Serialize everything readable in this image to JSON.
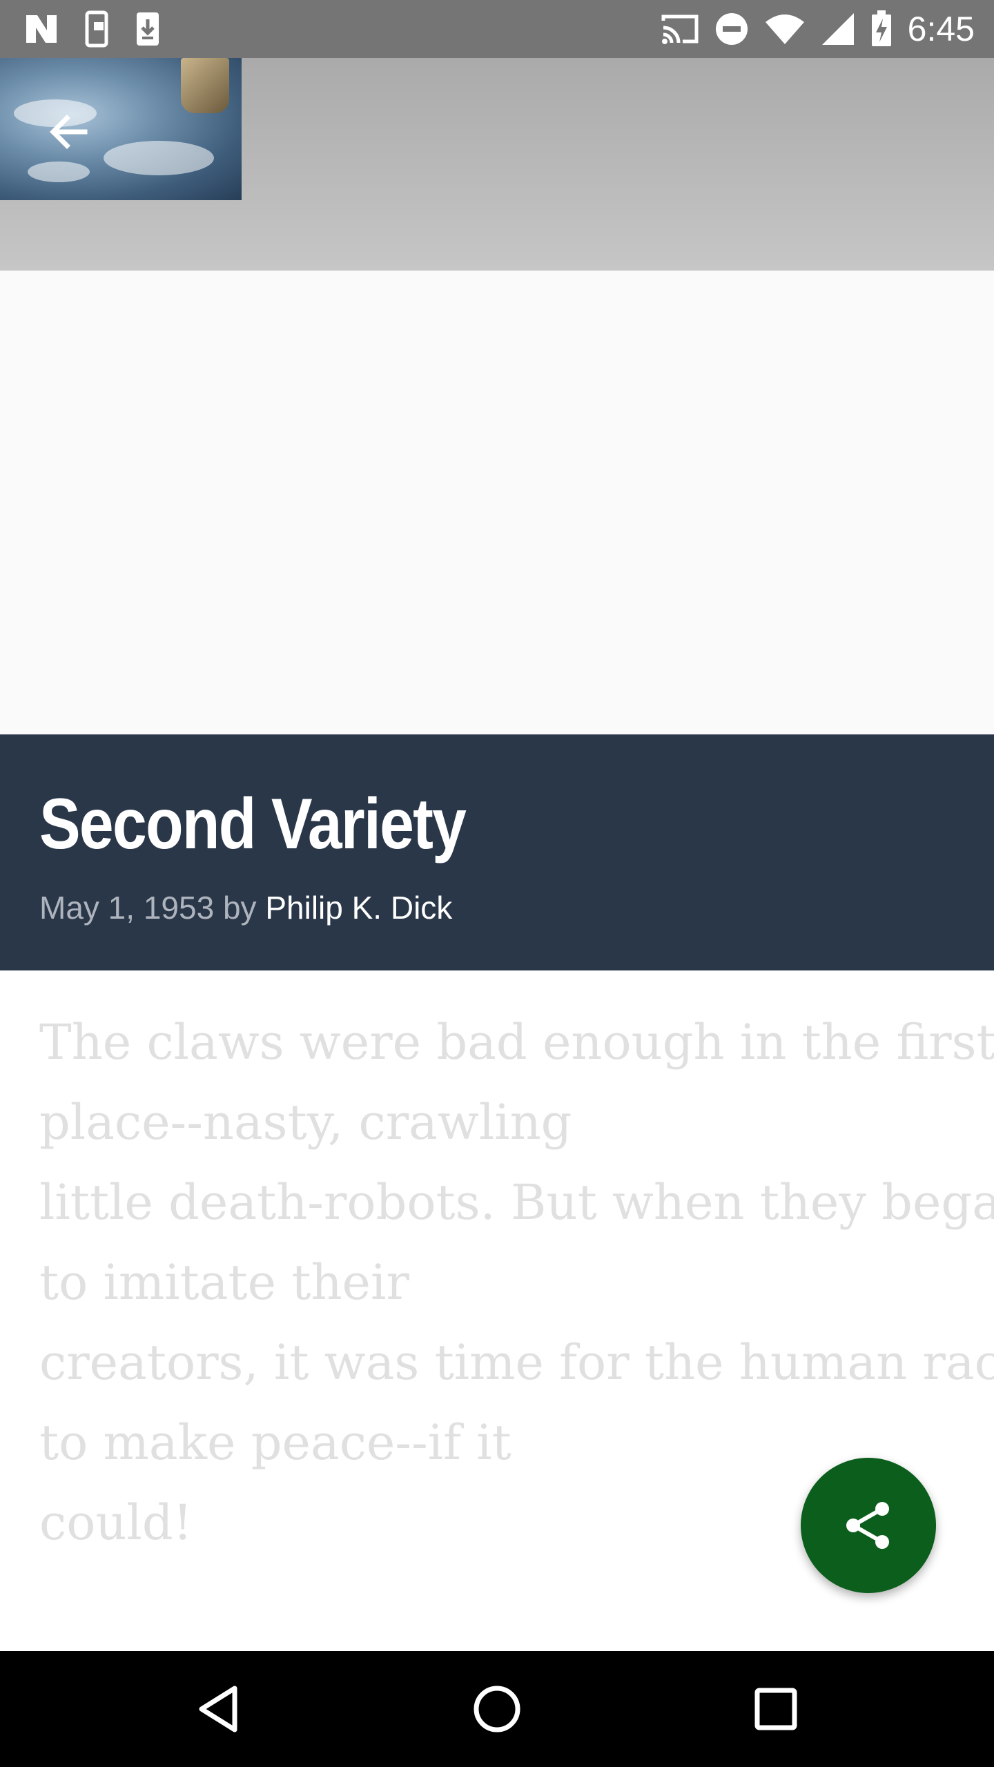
{
  "status_bar": {
    "time": "6:45",
    "left_icons": [
      "app-n-icon",
      "phone-lock-icon",
      "download-icon"
    ],
    "right_icons": [
      "cast-icon",
      "do-not-disturb-icon",
      "wifi-icon",
      "signal-icon",
      "battery-charging-icon"
    ]
  },
  "app_bar": {
    "back_icon": "arrow-back-icon"
  },
  "story": {
    "title": "Second Variety",
    "date": "May 1, 1953",
    "by": "by",
    "author": "Philip K. Dick",
    "excerpt_lines": [
      "The claws were bad enough in the first",
      "place--nasty, crawling",
      "little death-robots. But when they began",
      "to imitate their",
      "creators, it was time for the human race",
      "to make peace--if it",
      "could!"
    ]
  },
  "fab": {
    "icon": "share-icon",
    "color": "#0b5e1c"
  },
  "colors": {
    "title_block": "#2a3749",
    "status_bar": "#757575"
  },
  "nav_bar": {
    "buttons": [
      "back-triangle-icon",
      "home-circle-icon",
      "recents-square-icon"
    ]
  }
}
